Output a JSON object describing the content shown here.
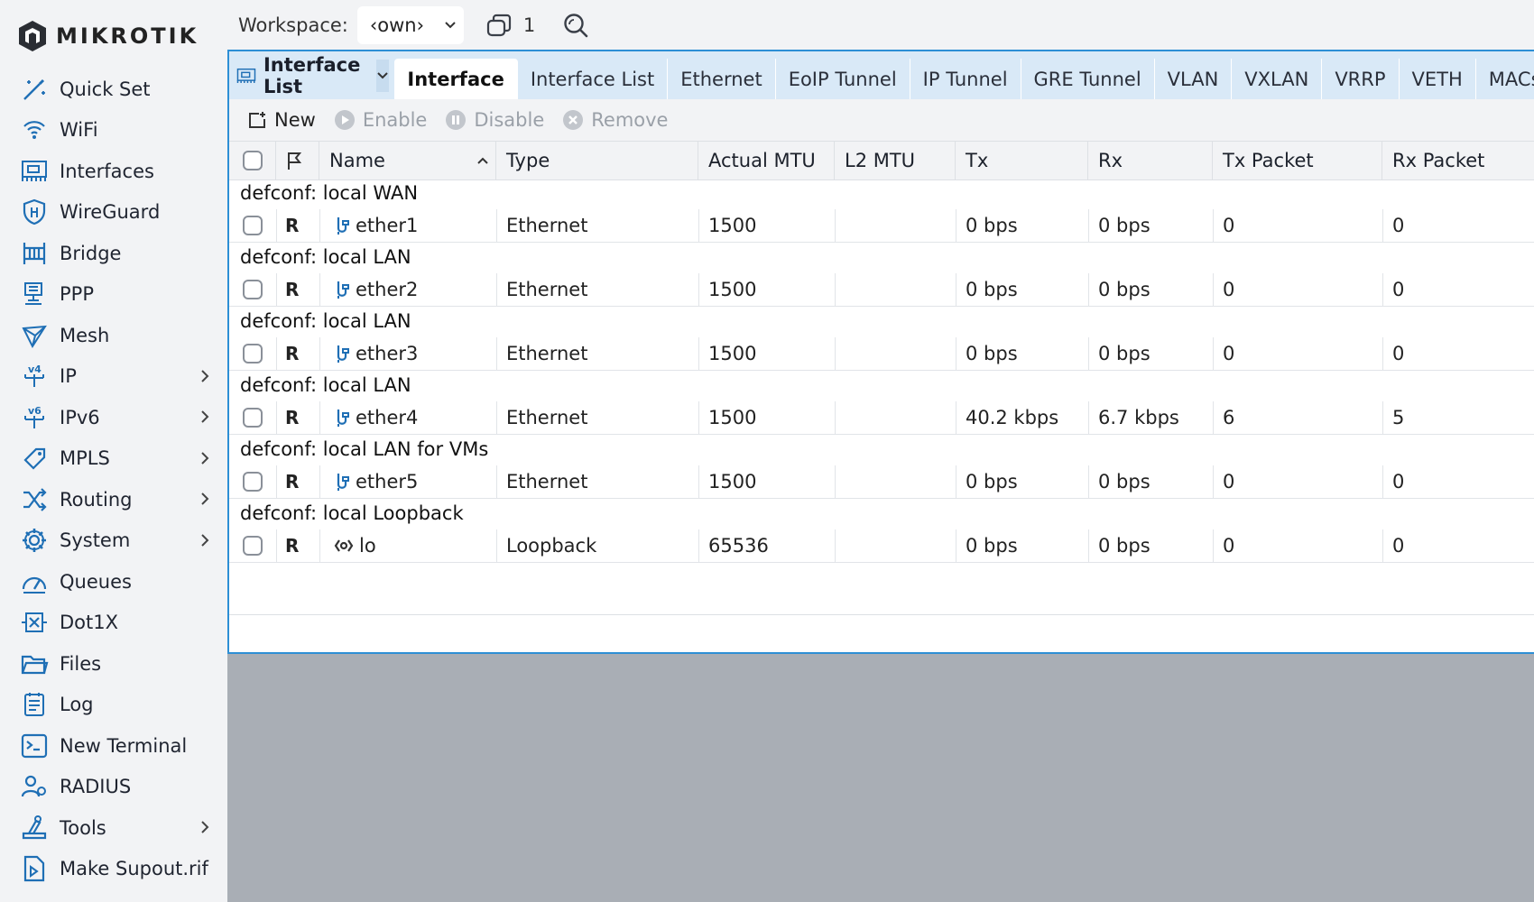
{
  "brand": {
    "name": "MIKROTIK"
  },
  "sidebar": {
    "items": [
      {
        "label": "Quick Set",
        "icon": "wand-icon",
        "submenu": false
      },
      {
        "label": "WiFi",
        "icon": "wifi-icon",
        "submenu": false
      },
      {
        "label": "Interfaces",
        "icon": "interfaces-icon",
        "submenu": false
      },
      {
        "label": "WireGuard",
        "icon": "wireguard-icon",
        "submenu": false
      },
      {
        "label": "Bridge",
        "icon": "bridge-icon",
        "submenu": false
      },
      {
        "label": "PPP",
        "icon": "ppp-icon",
        "submenu": false
      },
      {
        "label": "Mesh",
        "icon": "mesh-icon",
        "submenu": false
      },
      {
        "label": "IP",
        "icon": "ipv4-icon",
        "submenu": true
      },
      {
        "label": "IPv6",
        "icon": "ipv6-icon",
        "submenu": true
      },
      {
        "label": "MPLS",
        "icon": "mpls-icon",
        "submenu": true
      },
      {
        "label": "Routing",
        "icon": "routing-icon",
        "submenu": true
      },
      {
        "label": "System",
        "icon": "gear-icon",
        "submenu": true
      },
      {
        "label": "Queues",
        "icon": "queues-icon",
        "submenu": false
      },
      {
        "label": "Dot1X",
        "icon": "dot1x-icon",
        "submenu": false
      },
      {
        "label": "Files",
        "icon": "folder-icon",
        "submenu": false
      },
      {
        "label": "Log",
        "icon": "log-icon",
        "submenu": false
      },
      {
        "label": "New Terminal",
        "icon": "terminal-icon",
        "submenu": false
      },
      {
        "label": "RADIUS",
        "icon": "radius-icon",
        "submenu": false
      },
      {
        "label": "Tools",
        "icon": "tools-icon",
        "submenu": true
      },
      {
        "label": "Make Supout.rif",
        "icon": "supout-icon",
        "submenu": false
      }
    ]
  },
  "topbar": {
    "workspace_label": "Workspace:",
    "workspace_value": "‹own›",
    "window_count": "1"
  },
  "panel": {
    "title": "Interface List",
    "tabs": [
      "Interface",
      "Interface List",
      "Ethernet",
      "EoIP Tunnel",
      "IP Tunnel",
      "GRE Tunnel",
      "VLAN",
      "VXLAN",
      "VRRP",
      "VETH",
      "MACse"
    ],
    "active_tab": "Interface",
    "toolbar": {
      "new": "New",
      "enable": "Enable",
      "disable": "Disable",
      "remove": "Remove"
    }
  },
  "table": {
    "columns": [
      "Name",
      "Type",
      "Actual MTU",
      "L2 MTU",
      "Tx",
      "Rx",
      "Tx Packet",
      "Rx Packet"
    ],
    "rows": [
      {
        "comment": "defconf: local WAN",
        "flag": "R",
        "name": "ether1",
        "type": "Ethernet",
        "mtu": "1500",
        "l2mtu": "",
        "tx": "0 bps",
        "rx": "0 bps",
        "txp": "0",
        "rxp": "0",
        "icon": "ethernet-icon"
      },
      {
        "comment": "defconf: local LAN",
        "flag": "R",
        "name": "ether2",
        "type": "Ethernet",
        "mtu": "1500",
        "l2mtu": "",
        "tx": "0 bps",
        "rx": "0 bps",
        "txp": "0",
        "rxp": "0",
        "icon": "ethernet-icon"
      },
      {
        "comment": "defconf: local LAN",
        "flag": "R",
        "name": "ether3",
        "type": "Ethernet",
        "mtu": "1500",
        "l2mtu": "",
        "tx": "0 bps",
        "rx": "0 bps",
        "txp": "0",
        "rxp": "0",
        "icon": "ethernet-icon"
      },
      {
        "comment": "defconf: local LAN",
        "flag": "R",
        "name": "ether4",
        "type": "Ethernet",
        "mtu": "1500",
        "l2mtu": "",
        "tx": "40.2 kbps",
        "rx": "6.7 kbps",
        "txp": "6",
        "rxp": "5",
        "icon": "ethernet-icon"
      },
      {
        "comment": "defconf: local LAN for VMs",
        "flag": "R",
        "name": "ether5",
        "type": "Ethernet",
        "mtu": "1500",
        "l2mtu": "",
        "tx": "0 bps",
        "rx": "0 bps",
        "txp": "0",
        "rxp": "0",
        "icon": "ethernet-icon"
      },
      {
        "comment": "defconf: local Loopback",
        "flag": "R",
        "name": "lo",
        "type": "Loopback",
        "mtu": "65536",
        "l2mtu": "",
        "tx": "0 bps",
        "rx": "0 bps",
        "txp": "0",
        "rxp": "0",
        "icon": "loopback-icon"
      }
    ]
  },
  "colors": {
    "accent": "#2d8fd5",
    "icon_blue": "#1f6fb5",
    "tabbar": "#d9e9f7"
  }
}
